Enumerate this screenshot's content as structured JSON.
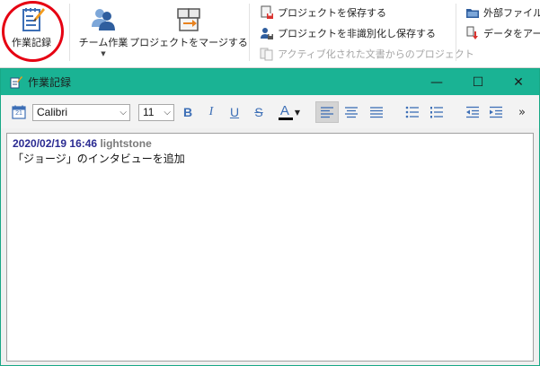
{
  "ribbon": {
    "work_log": {
      "label": "作業記録",
      "icon": "notebook-pencil-icon"
    },
    "team_work": {
      "label": "チーム作業",
      "icon": "team-users-icon",
      "dropdown": "▼"
    },
    "merge_project": {
      "label": "プロジェクトをマージする",
      "icon": "merge-project-icon"
    },
    "small_commands": [
      {
        "label": "プロジェクトを保存する",
        "icon": "save-project-icon",
        "enabled": true
      },
      {
        "label": "プロジェクトを非識別化し保存する",
        "icon": "anonymize-save-icon",
        "enabled": true
      },
      {
        "label": "アクティブ化された文書からのプロジェクト",
        "icon": "project-from-documents-icon",
        "enabled": false
      }
    ],
    "right_commands": [
      {
        "label": "外部ファイル",
        "icon": "folder-icon"
      },
      {
        "label": "データをアーカ",
        "icon": "archive-data-icon"
      }
    ]
  },
  "window": {
    "title": "作業記録",
    "title_icon": "notebook-pencil-icon",
    "minimize": "—",
    "maximize": "☐",
    "close": "✕"
  },
  "toolbar": {
    "calendar_day": "21",
    "font_name": "Calibri",
    "font_size": "11",
    "bold": "B",
    "italic": "I",
    "underline": "U",
    "strike": "S",
    "font_color_letter": "A",
    "more": "»",
    "colors": {
      "accent": "#3d6fb6",
      "font_color_bar": "#000000"
    }
  },
  "editor": {
    "entry": {
      "date": "2020/02/19 16:46",
      "user": "lightstone",
      "text": "「ジョージ」のインタビューを追加"
    }
  },
  "colors": {
    "title_bar": "#1ab394",
    "highlight_ring": "#e60012",
    "date_text": "#2b2b92",
    "user_text": "#7a7a7a"
  }
}
